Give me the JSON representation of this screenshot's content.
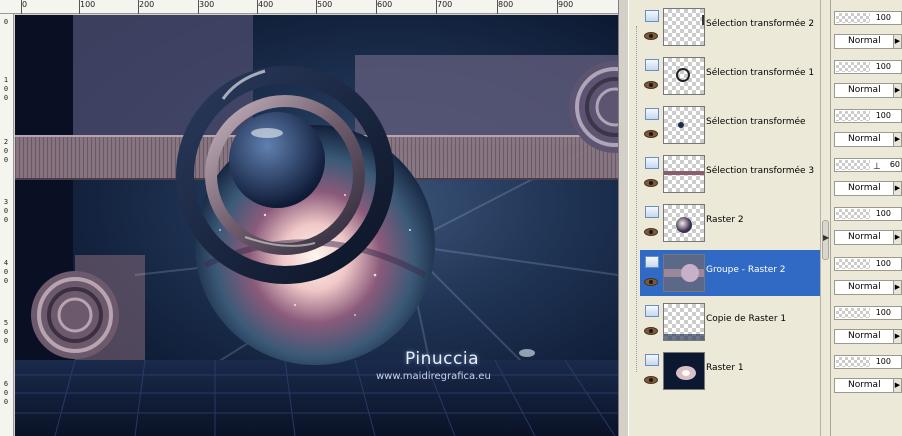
{
  "ruler": {
    "top_labels": [
      "0",
      "100",
      "200",
      "300",
      "400",
      "500",
      "600",
      "700",
      "800",
      "900"
    ],
    "left_labels": [
      "0",
      "1",
      "0",
      "0",
      "2",
      "0",
      "0",
      "3",
      "0",
      "0",
      "4",
      "0",
      "0",
      "5",
      "0",
      "0",
      "6",
      "0",
      "0"
    ]
  },
  "canvas": {
    "watermark_title": "Pinuccia",
    "watermark_url": "www.maidiregrafica.eu"
  },
  "layers": [
    {
      "name": "Sélection transformée 2",
      "thumb": "ring-edge",
      "opacity": "100",
      "blend": "Normal",
      "selected": false
    },
    {
      "name": "Sélection transformée 1",
      "thumb": "small-ring",
      "opacity": "100",
      "blend": "Normal",
      "selected": false
    },
    {
      "name": "Sélection transformée",
      "thumb": "dot",
      "opacity": "100",
      "blend": "Normal",
      "selected": false
    },
    {
      "name": "Sélection transformée 3",
      "thumb": "band",
      "opacity": "60",
      "blend": "Normal",
      "selected": false
    },
    {
      "name": "Raster 2",
      "thumb": "sphere",
      "opacity": "100",
      "blend": "Normal",
      "selected": false
    },
    {
      "name": "Groupe - Raster 2",
      "thumb": "group",
      "opacity": "100",
      "blend": "Normal",
      "selected": true
    },
    {
      "name": "Copie de Raster 1",
      "thumb": "faint",
      "opacity": "100",
      "blend": "Normal",
      "selected": false
    },
    {
      "name": "Raster 1",
      "thumb": "galaxy",
      "opacity": "100",
      "blend": "Normal",
      "selected": false
    }
  ],
  "colors": {
    "selection": "#316ac5",
    "palette_bg": "#ece9d8",
    "canvas_base": "#1e3252",
    "band": "#8c7884"
  },
  "icons": {
    "visibility": "eye-icon",
    "layer_toggle": "layer-group-icon",
    "dropdown": "triangle-right-icon",
    "scroll": "triangle-right-icon"
  }
}
